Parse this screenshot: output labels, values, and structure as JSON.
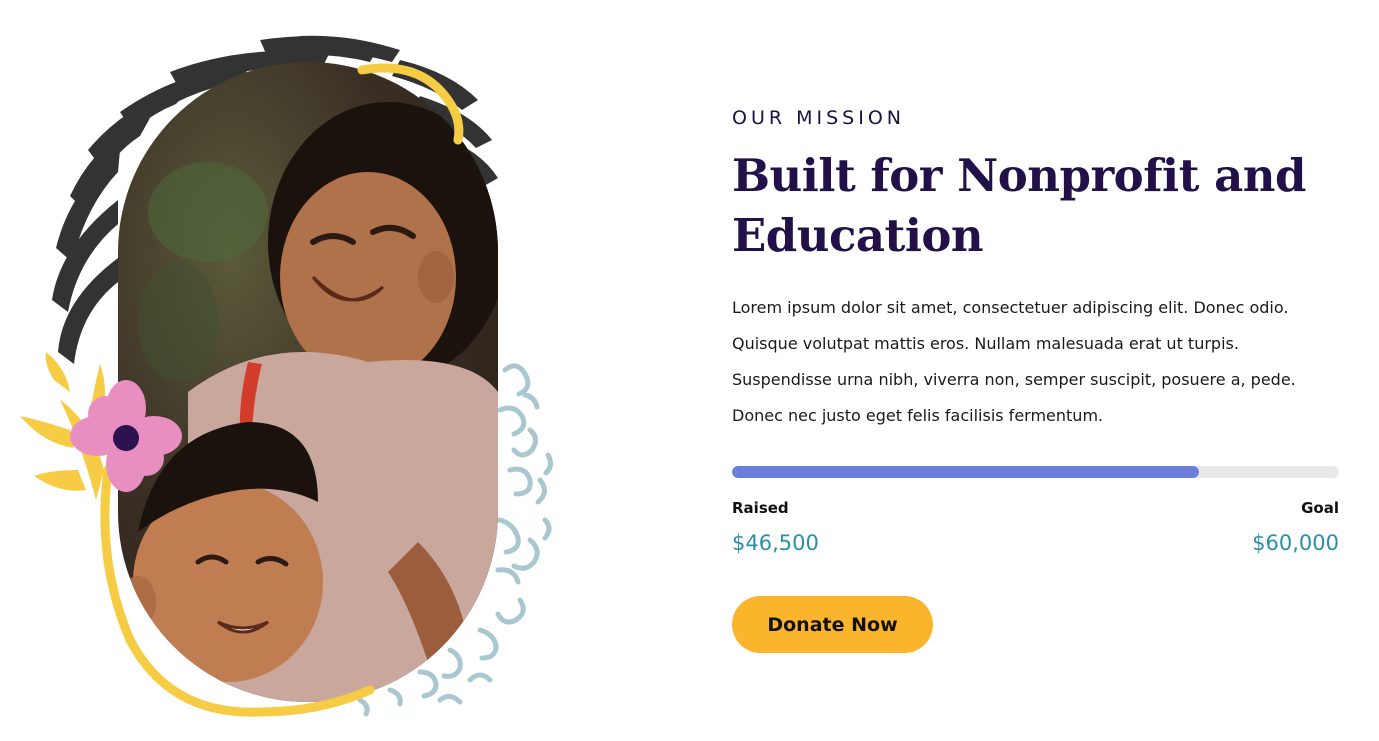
{
  "mission": {
    "eyebrow": "OUR MISSION",
    "headline": "Built for Nonprofit and Education",
    "body": "Lorem ipsum dolor sit amet, consectetuer adipiscing elit. Donec odio. Quisque volutpat mattis eros. Nullam malesuada erat ut turpis. Suspendisse urna nibh, viverra non, semper suscipit, posuere a, pede. Donec nec justo eget felis facilisis fermentum."
  },
  "fundraising": {
    "raised_label": "Raised",
    "raised_value": "$46,500",
    "goal_label": "Goal",
    "goal_value": "$60,000",
    "progress_fraction": 0.77
  },
  "cta": {
    "donate_label": "Donate Now"
  },
  "colors": {
    "accent_yellow": "#fbb52c",
    "progress_blue": "#6b80dd",
    "amount_teal": "#2b8fa8",
    "headline_navy": "#221049"
  },
  "icons": [
    "zebra-stripe-decoration",
    "yellow-loop-decoration",
    "pink-flower-icon",
    "leaf-sprig-icon",
    "doodle-pattern-decoration"
  ]
}
